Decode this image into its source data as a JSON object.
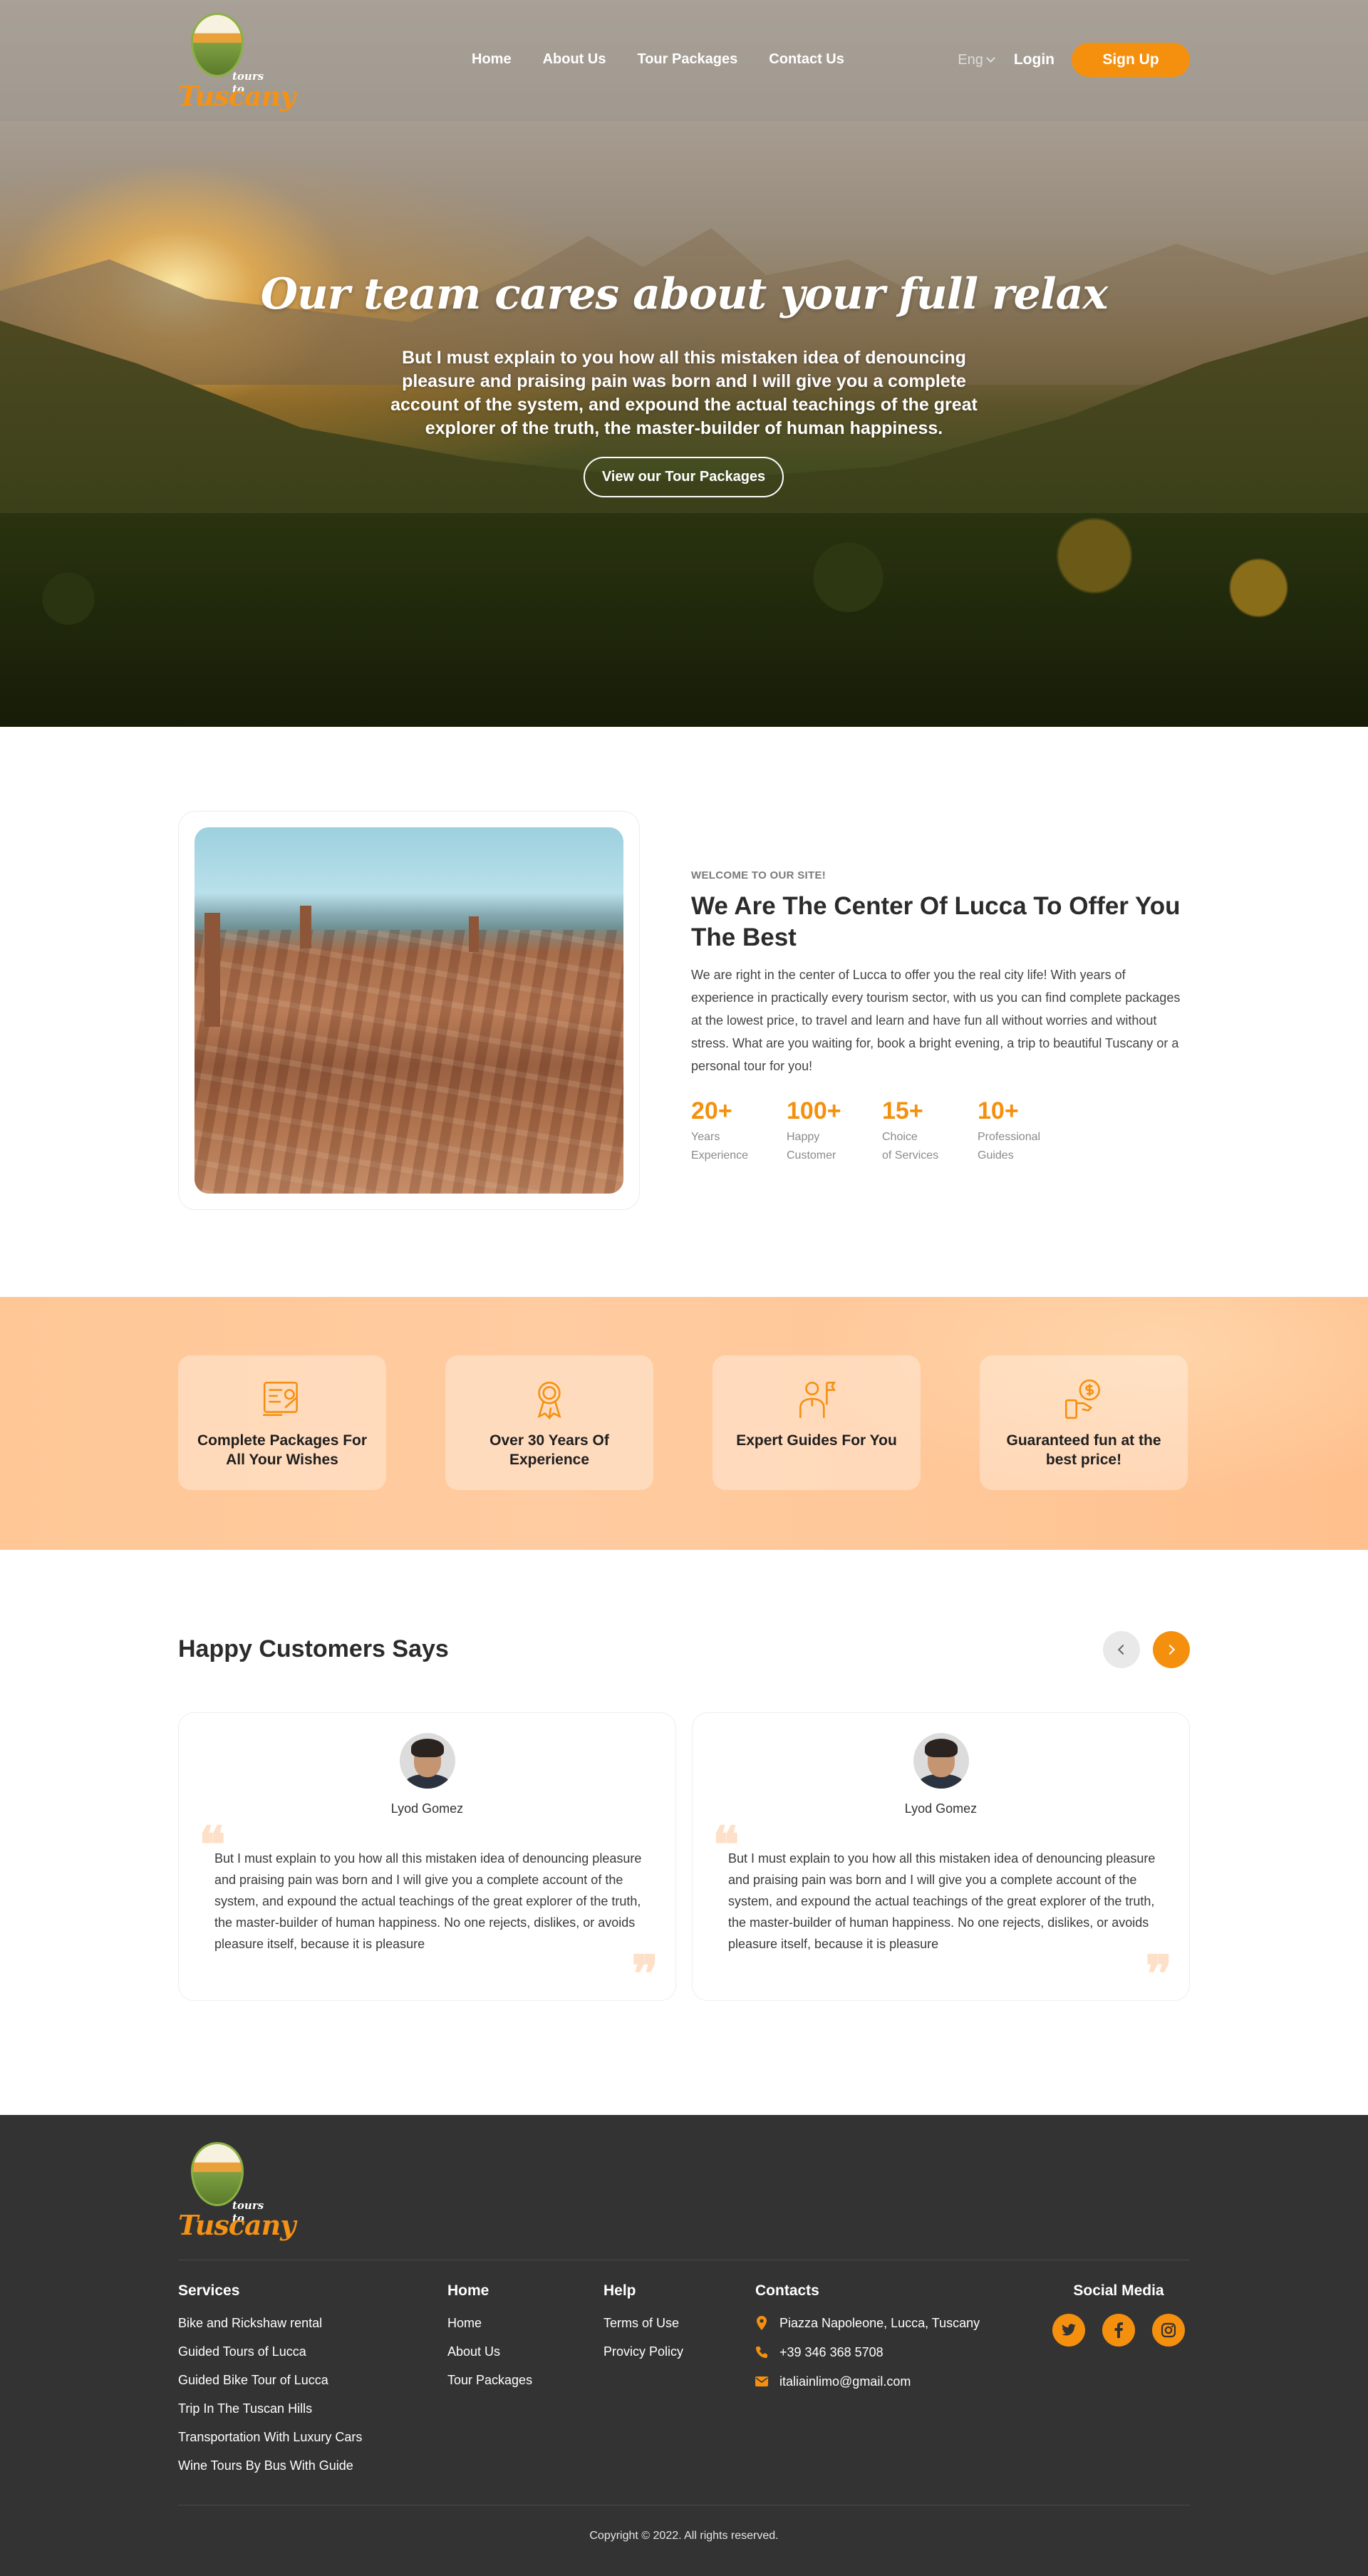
{
  "brand": {
    "tours": "tours to",
    "name": "Tuscany"
  },
  "nav": {
    "items": [
      "Home",
      "About Us",
      "Tour Packages",
      "Contact Us"
    ],
    "lang": "Eng",
    "login": "Login",
    "signup": "Sign Up"
  },
  "hero": {
    "title": "Our team cares about your full relax",
    "text": "But I must explain to you how all this mistaken idea of denouncing pleasure and praising pain was born and I will give you a complete account of the system, and expound the actual teachings of the great explorer of the truth, the master-builder of human happiness.",
    "button": "View our Tour Packages"
  },
  "about": {
    "eyebrow": "WELCOME TO OUR SITE!",
    "heading": "We Are The Center Of Lucca To Offer You The Best",
    "paragraph": "We are right in the center of Lucca to offer you the real city life! With years of experience in practically every tourism sector, with us you can find complete packages at the lowest price, to travel and learn and have fun all without worries and without stress. What are you waiting for, book a bright evening, a trip to beautiful Tuscany or a personal tour for you!",
    "stats": [
      {
        "num": "20+",
        "label": "Years\nExperience"
      },
      {
        "num": "100+",
        "label": "Happy\nCustomer"
      },
      {
        "num": "15+",
        "label": "Choice\nof Services"
      },
      {
        "num": "10+",
        "label": "Professional\nGuides"
      }
    ]
  },
  "features": [
    {
      "icon": "packages-icon",
      "title": "Complete Packages For\nAll Your Wishes"
    },
    {
      "icon": "award-icon",
      "title": "Over 30 Years Of\nExperience"
    },
    {
      "icon": "guide-icon",
      "title": "Expert Guides For You"
    },
    {
      "icon": "price-icon",
      "title": "Guaranteed fun at the\nbest price!"
    }
  ],
  "testimonials": {
    "heading": "Happy Customers Says",
    "items": [
      {
        "name": "Lyod Gomez",
        "text": "But I must explain to you how all this mistaken idea of denouncing pleasure and praising pain was born and I will give you a complete account of the system, and expound the actual teachings of the great explorer of the truth, the master-builder of human happiness. No one rejects, dislikes, or avoids pleasure itself, because it is pleasure"
      },
      {
        "name": "Lyod Gomez",
        "text": "But I must explain to you how all this mistaken idea of denouncing pleasure and praising pain was born and I will give you a complete account of the system, and expound the actual teachings of the great explorer of the truth, the master-builder of human happiness. No one rejects, dislikes, or avoids pleasure itself, because it is pleasure"
      }
    ]
  },
  "footer": {
    "services": {
      "title": "Services",
      "links": [
        "Bike and Rickshaw rental",
        "Guided Tours of Lucca",
        "Guided Bike Tour of Lucca",
        "Trip In The Tuscan Hills",
        "Transportation With Luxury Cars",
        "Wine Tours By Bus With Guide"
      ]
    },
    "home": {
      "title": "Home",
      "links": [
        "Home",
        "About Us",
        "Tour Packages"
      ]
    },
    "help": {
      "title": "Help",
      "links": [
        "Terms of Use",
        "Provicy Policy"
      ]
    },
    "contacts": {
      "title": "Contacts",
      "address": "Piazza Napoleone, Lucca, Tuscany",
      "phone": "+39 346 368 5708",
      "email": "italiainlimo@gmail.com"
    },
    "social": {
      "title": "Social Media",
      "icons": [
        "twitter-icon",
        "facebook-icon",
        "instagram-icon"
      ]
    },
    "copyright": "Copyright © 2022.  All rights reserved."
  },
  "colors": {
    "accent": "#f5900f",
    "footer_bg": "#333333",
    "features_bg": "#ffc796"
  }
}
